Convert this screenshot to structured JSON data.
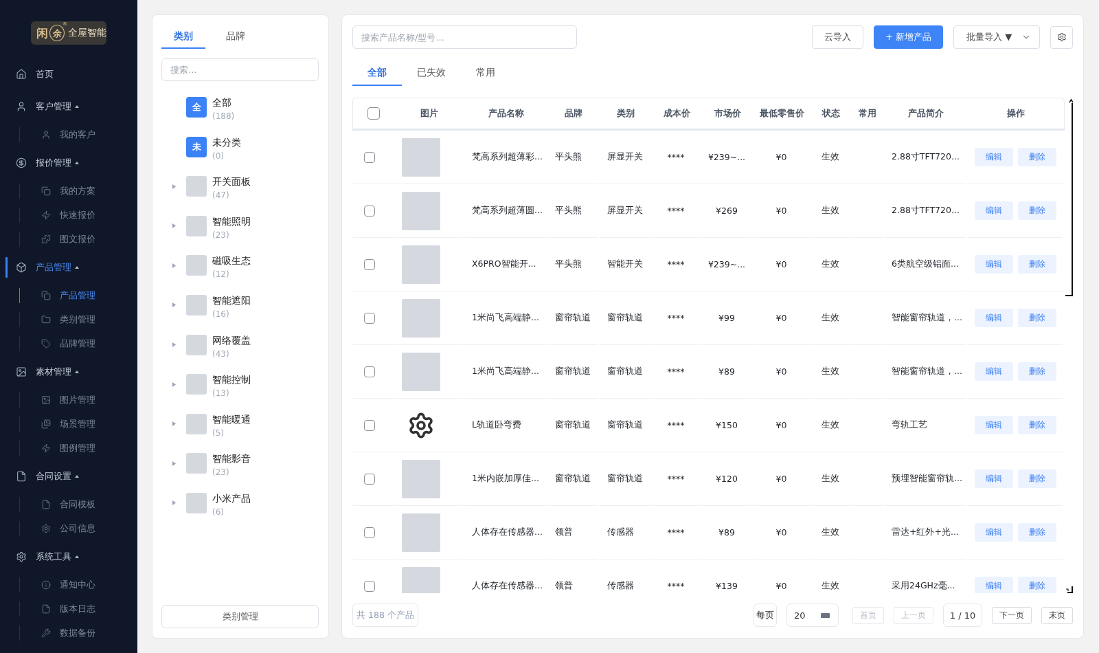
{
  "sidebar": {
    "logo": {
      "glyph_1": "闲",
      "glyph_2": "余",
      "registered": "®",
      "name": "全屋智能"
    },
    "items": [
      {
        "label": "首页",
        "selected": false
      },
      {
        "label": "客户管理",
        "selected": false,
        "expanded": true,
        "children": [
          {
            "label": "我的客户",
            "selected": false
          }
        ]
      },
      {
        "label": "报价管理",
        "selected": false,
        "expanded": true,
        "children": [
          {
            "label": "我的方案",
            "selected": false
          },
          {
            "label": "快速报价",
            "selected": false
          },
          {
            "label": "图文报价",
            "selected": false
          }
        ]
      },
      {
        "label": "产品管理",
        "selected": true,
        "expanded": true,
        "children": [
          {
            "label": "产品管理",
            "selected": true
          },
          {
            "label": "类别管理",
            "selected": false
          },
          {
            "label": "品牌管理",
            "selected": false
          }
        ]
      },
      {
        "label": "素材管理",
        "selected": false,
        "expanded": true,
        "children": [
          {
            "label": "图片管理",
            "selected": false
          },
          {
            "label": "场景管理",
            "selected": false
          },
          {
            "label": "图例管理",
            "selected": false
          }
        ]
      },
      {
        "label": "合同设置",
        "selected": false,
        "expanded": true,
        "children": [
          {
            "label": "合同模板",
            "selected": false
          },
          {
            "label": "公司信息",
            "selected": false
          }
        ]
      },
      {
        "label": "系统工具",
        "selected": false,
        "expanded": true,
        "children": [
          {
            "label": "通知中心",
            "selected": false
          },
          {
            "label": "版本日志",
            "selected": false
          },
          {
            "label": "数据备份",
            "selected": false
          }
        ]
      }
    ]
  },
  "category_panel": {
    "tabs": [
      {
        "label": "类别",
        "selected": true
      },
      {
        "label": "品牌",
        "selected": false
      }
    ],
    "search": {
      "placeholder": "搜索..."
    },
    "categories": [
      {
        "kind": "letter",
        "badge": "全",
        "name": "全部",
        "count": "(188)"
      },
      {
        "kind": "letter",
        "badge": "未",
        "name": "未分类",
        "count": "(0)"
      },
      {
        "kind": "photo",
        "name": "开关面板",
        "count": "(47)",
        "expanded": false
      },
      {
        "kind": "photo",
        "name": "智能照明",
        "count": "(23)",
        "expanded": false
      },
      {
        "kind": "photo",
        "name": "磁吸生态",
        "count": "(12)",
        "expanded": false
      },
      {
        "kind": "photo",
        "name": "智能遮阳",
        "count": "(16)",
        "expanded": false
      },
      {
        "kind": "photo",
        "name": "网络覆盖",
        "count": "(43)",
        "expanded": false
      },
      {
        "kind": "photo",
        "name": "智能控制",
        "count": "(13)",
        "expanded": false
      },
      {
        "kind": "photo",
        "name": "智能暖通",
        "count": "(5)",
        "expanded": false
      },
      {
        "kind": "photo",
        "name": "智能影音",
        "count": "(23)",
        "expanded": false
      },
      {
        "kind": "photo",
        "name": "小米产品",
        "count": "(6)",
        "expanded": false
      }
    ],
    "manage_button": "类别管理"
  },
  "toolbar": {
    "search": {
      "placeholder": "搜索产品名称/型号..."
    },
    "buttons": [
      {
        "kind": "outline",
        "label": "云导入"
      },
      {
        "kind": "primary",
        "label": "+ 新增产品"
      },
      {
        "kind": "dropdown",
        "label": "批量导入 ▼"
      },
      {
        "kind": "icon"
      }
    ]
  },
  "tabs": [
    {
      "label": "全部",
      "selected": true
    },
    {
      "label": "已失效",
      "selected": false
    },
    {
      "label": "常用",
      "selected": false
    }
  ],
  "table": {
    "select_all": {
      "checked": false
    },
    "columns": [
      "图片",
      "产品名称",
      "品牌",
      "类别",
      "成本价",
      "市场价",
      "最低零售价",
      "状态",
      "常用",
      "产品简介",
      "操作"
    ],
    "rows": [
      {
        "kind": "photo",
        "checked": false,
        "name": "梵高系列超薄彩...",
        "brand": "平头熊",
        "category": "屏显开关",
        "cost": "****",
        "market_price": "¥239~...",
        "min_price": "¥0",
        "status": "生效",
        "intro": "2.88寸TFT720...",
        "actions": [
          "编辑",
          "删除"
        ]
      },
      {
        "kind": "photo",
        "checked": false,
        "name": "梵高系列超薄圆...",
        "brand": "平头熊",
        "category": "屏显开关",
        "cost": "****",
        "market_price": "¥269",
        "min_price": "¥0",
        "status": "生效",
        "intro": "2.88寸TFT720...",
        "actions": [
          "编辑",
          "删除"
        ]
      },
      {
        "kind": "photo",
        "checked": false,
        "name": "X6PRO智能开...",
        "brand": "平头熊",
        "category": "智能开关",
        "cost": "****",
        "market_price": "¥239~...",
        "min_price": "¥0",
        "status": "生效",
        "intro": "6类航空级铝面...",
        "actions": [
          "编辑",
          "删除"
        ]
      },
      {
        "kind": "photo",
        "checked": false,
        "name": "1米尚飞高端静...",
        "brand": "窗帘轨道",
        "category": "窗帘轨道",
        "cost": "****",
        "market_price": "¥99",
        "min_price": "¥0",
        "status": "生效",
        "intro": "智能窗帘轨道，...",
        "actions": [
          "编辑",
          "删除"
        ]
      },
      {
        "kind": "photo",
        "checked": false,
        "name": "1米尚飞高端静...",
        "brand": "窗帘轨道",
        "category": "窗帘轨道",
        "cost": "****",
        "market_price": "¥89",
        "min_price": "¥0",
        "status": "生效",
        "intro": "智能窗帘轨道，...",
        "actions": [
          "编辑",
          "删除"
        ]
      },
      {
        "kind": "icon",
        "checked": false,
        "name": "L轨道卧弯费",
        "brand": "窗帘轨道",
        "category": "窗帘轨道",
        "cost": "****",
        "market_price": "¥150",
        "min_price": "¥0",
        "status": "生效",
        "intro": "弯轨工艺",
        "actions": [
          "编辑",
          "删除"
        ]
      },
      {
        "kind": "photo",
        "checked": false,
        "name": "1米内嵌加厚佳...",
        "brand": "窗帘轨道",
        "category": "窗帘轨道",
        "cost": "****",
        "market_price": "¥120",
        "min_price": "¥0",
        "status": "生效",
        "intro": "预埋智能窗帘轨...",
        "actions": [
          "编辑",
          "删除"
        ]
      },
      {
        "kind": "photo",
        "checked": false,
        "name": "人体存在传感器...",
        "brand": "领普",
        "category": "传感器",
        "cost": "****",
        "market_price": "¥89",
        "min_price": "¥0",
        "status": "生效",
        "intro": "雷达+红外+光...",
        "actions": [
          "编辑",
          "删除"
        ]
      },
      {
        "kind": "photo",
        "checked": false,
        "name": "人体存在传感器...",
        "brand": "领普",
        "category": "传感器",
        "cost": "****",
        "market_price": "¥139",
        "min_price": "¥0",
        "status": "生效",
        "intro": "采用24GHz毫...",
        "actions": [
          "编辑",
          "删除"
        ]
      }
    ]
  },
  "pagination": {
    "total": "共 188 个产品",
    "per_page_label": "每页",
    "per_page": "20",
    "controls": [
      {
        "kind": "button",
        "label": "首页",
        "disabled": true
      },
      {
        "kind": "button",
        "label": "上一页",
        "disabled": true
      },
      {
        "kind": "indicator",
        "label": "1 / 10"
      },
      {
        "kind": "button",
        "label": "下一页",
        "disabled": false
      },
      {
        "kind": "button",
        "label": "末页",
        "disabled": false
      }
    ]
  }
}
